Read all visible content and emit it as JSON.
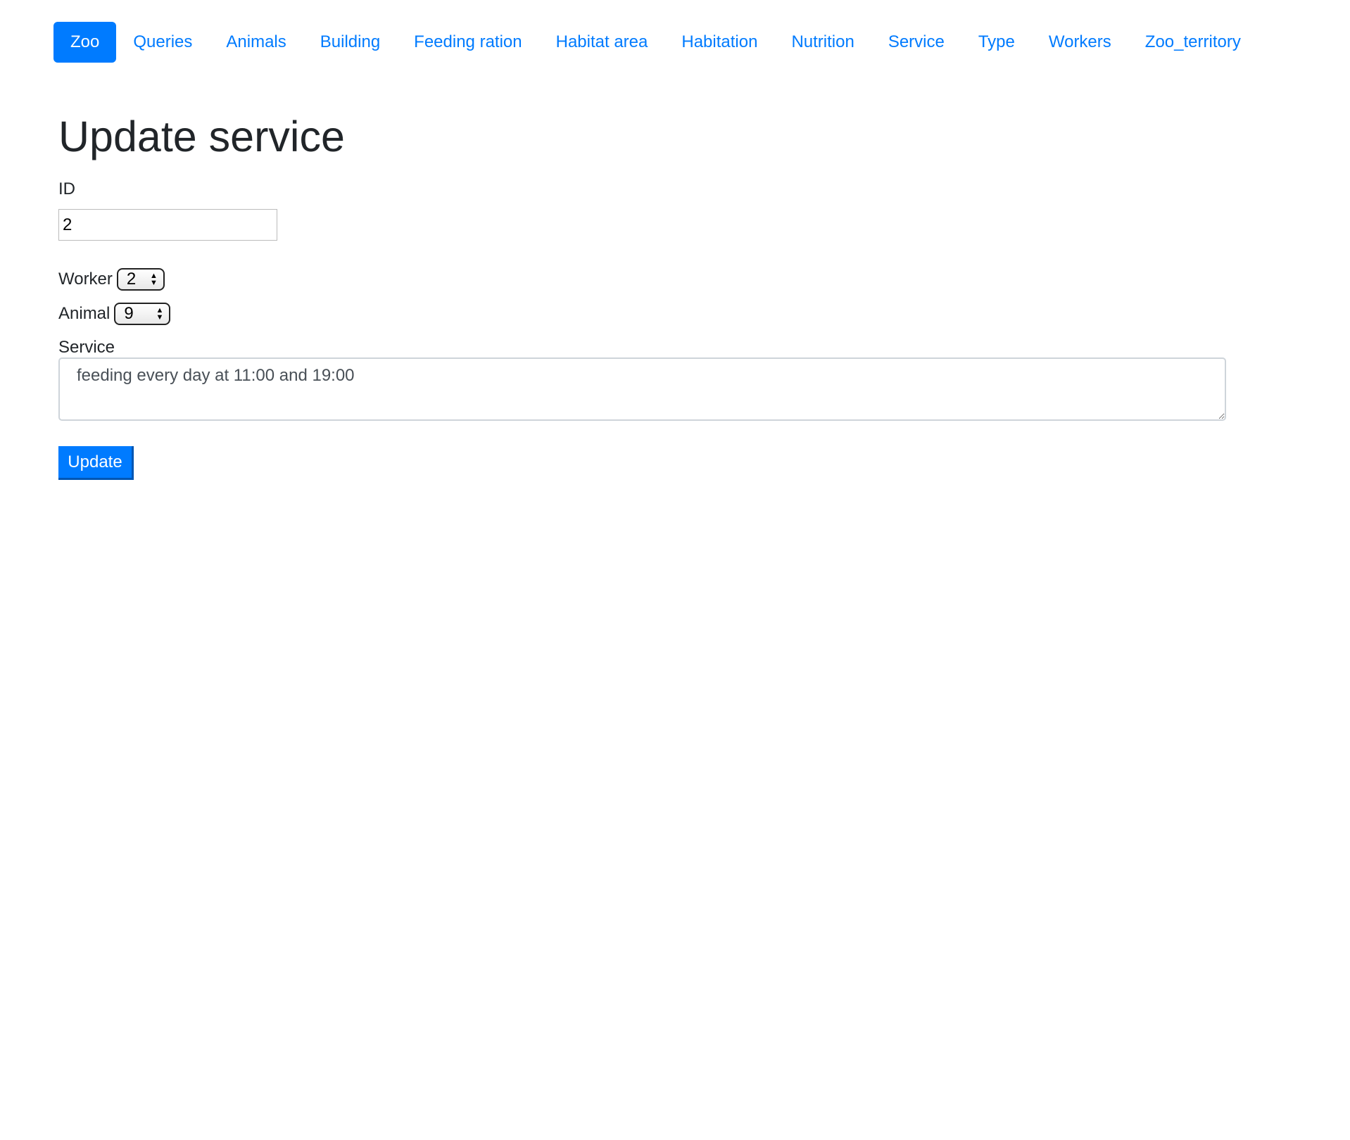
{
  "nav": {
    "items": [
      {
        "label": "Zoo",
        "active": true
      },
      {
        "label": "Queries"
      },
      {
        "label": "Animals"
      },
      {
        "label": "Building"
      },
      {
        "label": "Feeding ration"
      },
      {
        "label": "Habitat area"
      },
      {
        "label": "Habitation"
      },
      {
        "label": "Nutrition"
      },
      {
        "label": "Service"
      },
      {
        "label": "Type"
      },
      {
        "label": "Workers"
      },
      {
        "label": "Zoo_territory"
      }
    ]
  },
  "form": {
    "title": "Update service",
    "id_label": "ID",
    "id_value": "2",
    "worker_label": "Worker",
    "worker_value": "2",
    "animal_label": "Animal",
    "animal_value": "9",
    "service_label": "Service",
    "service_value": "feeding every day at 11:00 and 19:00",
    "submit_label": "Update"
  },
  "colors": {
    "accent": "#007bff"
  }
}
